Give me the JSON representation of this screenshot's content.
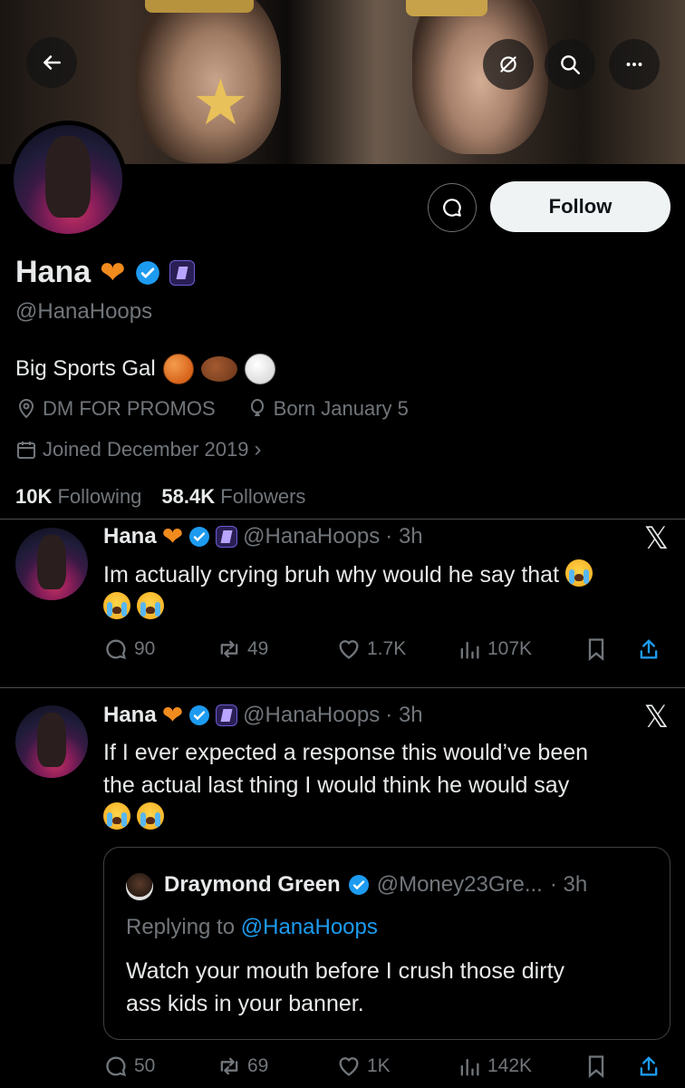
{
  "profile": {
    "name": "Hana",
    "handle": "@HanaHoops",
    "bio": "Big Sports Gal",
    "location": "DM FOR PROMOS",
    "birthday": "Born January 5",
    "joined": "Joined December 2019",
    "following_count": "10K",
    "following_label": "Following",
    "followers_count": "58.4K",
    "followers_label": "Followers",
    "follow_label": "Follow"
  },
  "icons": {
    "back": "arrow-left-icon",
    "notifications_off": "bell-off-icon",
    "search": "search-icon",
    "more": "more-icon",
    "message": "message-icon",
    "heart_emoji": "orange-heart-icon",
    "verified": "verified-badge-icon",
    "affiliate": "affiliate-badge-icon"
  },
  "tweets": [
    {
      "name": "Hana",
      "handle": "@HanaHoops",
      "time": "· 3h",
      "text": "Im actually crying bruh why would he say that",
      "replies": "90",
      "reposts": "49",
      "likes": "1.7K",
      "views": "107K"
    },
    {
      "name": "Hana",
      "handle": "@HanaHoops",
      "time": "· 3h",
      "text_line1": "If I ever expected a response this would’ve been",
      "text_line2": "the actual last thing I would think he would say",
      "replies": "50",
      "reposts": "69",
      "likes": "1K",
      "views": "142K",
      "quote": {
        "name": "Draymond Green",
        "handle": "@Money23Gre...",
        "time": "· 3h",
        "replying_prefix": "Replying to",
        "replying_to": "@HanaHoops",
        "text_line1": "Watch your mouth before I crush those dirty",
        "text_line2": "ass kids in your banner."
      }
    }
  ],
  "colors": {
    "background": "#000000",
    "text": "#e7e9ea",
    "muted": "#71767b",
    "link": "#1d9bf0",
    "verified": "#1d9bf0"
  }
}
